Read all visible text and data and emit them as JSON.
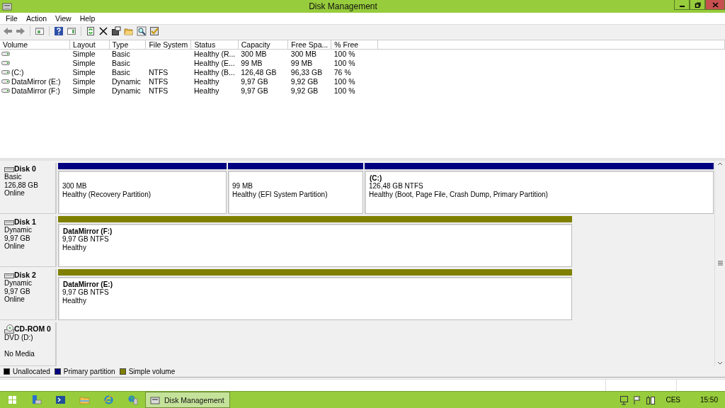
{
  "window": {
    "title": "Disk Management"
  },
  "menu": [
    "File",
    "Action",
    "View",
    "Help"
  ],
  "volumes": {
    "columns": [
      "Volume",
      "Layout",
      "Type",
      "File System",
      "Status",
      "Capacity",
      "Free Spa...",
      "% Free"
    ],
    "rows": [
      {
        "layout": "Simple",
        "type": "Basic",
        "status": "Healthy (R...",
        "capacity": "300 MB",
        "free_space": "300 MB",
        "percent_free": "100 %"
      },
      {
        "layout": "Simple",
        "type": "Basic",
        "status": "Healthy (E...",
        "capacity": "99 MB",
        "free_space": "99 MB",
        "percent_free": "100 %"
      },
      {
        "volume": "(C:)",
        "layout": "Simple",
        "type": "Basic",
        "file_system": "NTFS",
        "status": "Healthy (B...",
        "capacity": "126,48 GB",
        "free_space": "96,33 GB",
        "percent_free": "76 %"
      },
      {
        "volume": "DataMirror (E:)",
        "layout": "Simple",
        "type": "Dynamic",
        "file_system": "NTFS",
        "status": "Healthy",
        "capacity": "9,97 GB",
        "free_space": "9,92 GB",
        "percent_free": "100 %"
      },
      {
        "volume": "DataMirror (F:)",
        "layout": "Simple",
        "type": "Dynamic",
        "file_system": "NTFS",
        "status": "Healthy",
        "capacity": "9,97 GB",
        "free_space": "9,92 GB",
        "percent_free": "100 %"
      }
    ]
  },
  "disks": [
    {
      "name": "Disk 0",
      "kind": "disk",
      "type": "Basic",
      "size": "126,88 GB",
      "status": "Online",
      "partitions": [
        {
          "color": "#000080",
          "size": "300 MB",
          "status": "Healthy (Recovery Partition)"
        },
        {
          "color": "#000080",
          "size": "99 MB",
          "status": "Healthy (EFI System Partition)"
        },
        {
          "color": "#000080",
          "title": "(C:)",
          "size": "126,48 GB NTFS",
          "status": "Healthy (Boot, Page File, Crash Dump, Primary Partition)"
        }
      ]
    },
    {
      "name": "Disk 1",
      "kind": "disk",
      "type": "Dynamic",
      "size": "9,97 GB",
      "status": "Online",
      "partitions": [
        {
          "color": "#808000",
          "title": "DataMirror  (F:)",
          "size": "9,97 GB NTFS",
          "status": "Healthy"
        }
      ]
    },
    {
      "name": "Disk 2",
      "kind": "disk",
      "type": "Dynamic",
      "size": "9,97 GB",
      "status": "Online",
      "partitions": [
        {
          "color": "#808000",
          "title": "DataMirror  (E:)",
          "size": "9,97 GB NTFS",
          "status": "Healthy"
        }
      ]
    },
    {
      "name": "CD-ROM 0",
      "kind": "cdrom",
      "type": "DVD (D:)",
      "status": "No Media"
    }
  ],
  "legend": [
    {
      "label": "Unallocated",
      "color": "#000000"
    },
    {
      "label": "Primary partition",
      "color": "#000080"
    },
    {
      "label": "Simple volume",
      "color": "#808000"
    }
  ],
  "taskbar": {
    "windows": [
      {
        "label": "Disk Management",
        "selected": true
      }
    ],
    "language": "CES",
    "clock": "15:50"
  }
}
